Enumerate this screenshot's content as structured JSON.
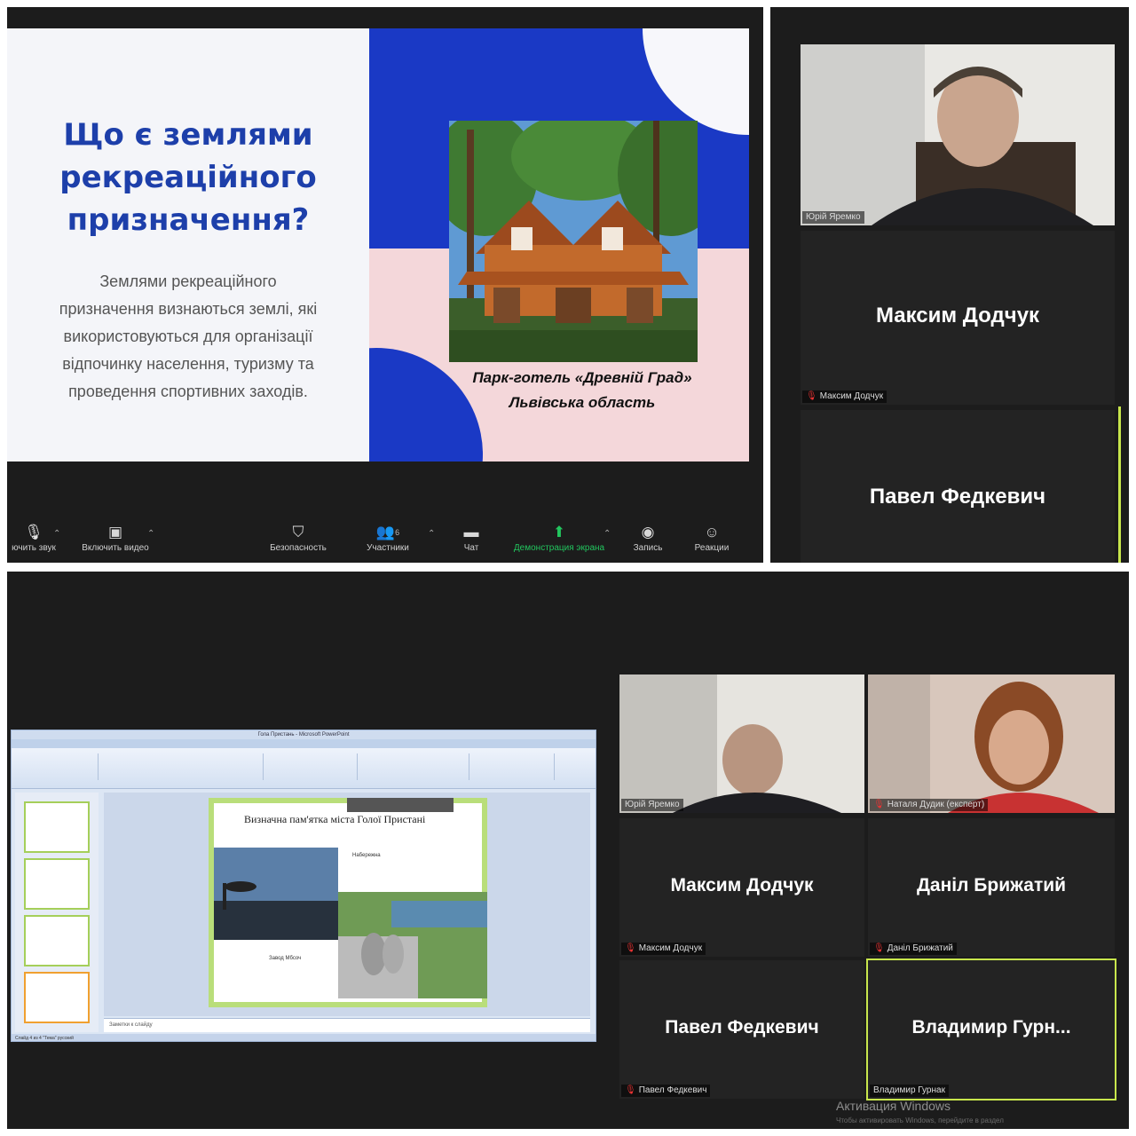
{
  "slide": {
    "title_lines": [
      "Що є землями",
      "рекреаційного",
      "призначення?"
    ],
    "body_lines": [
      "Землями рекреаційного",
      "призначення визнаються землі, які",
      "використовуються для організації",
      "відпочинку населення, туризму та",
      "проведення спортивних заходів."
    ],
    "caption_lines": [
      "Парк-готель «Древній Град»",
      "Львівська область"
    ]
  },
  "toolbar": {
    "mute_label": "ючить звук",
    "video_label": "Включить видео",
    "security_label": "Безопасность",
    "participants_label": "Участники",
    "participants_count": "6",
    "chat_label": "Чат",
    "share_label": "Демонстрация экрана",
    "record_label": "Запись",
    "reactions_label": "Реакции"
  },
  "top_gallery": {
    "tile1_tag": "Юрій Яремко",
    "tile2_name": "Максим Додчук",
    "tile2_tag": "Максим Додчук",
    "tile3_name": "Павел Федкевич"
  },
  "ppt": {
    "window_title": "Гола Пристань - Microsoft PowerPoint",
    "slide_title": "Визначна пам'ятка міста Голої Пристані",
    "label_a": "Набережна",
    "label_b": "Завод Мбсоч",
    "notes": "Заметки к слайду",
    "status": "Слайд 4 из 4   \"Тема\"   русский"
  },
  "bottom_gallery": {
    "tile1_tag": "Юрій Яремко",
    "tile2_tag": "Наталя Дудик (експерт)",
    "tile3_name": "Максим Додчук",
    "tile3_tag": "Максим Додчук",
    "tile4_name": "Даніл Брижатий",
    "tile4_tag": "Даніл Брижатий",
    "tile5_name": "Павел Федкевич",
    "tile5_tag": "Павел Федкевич",
    "tile6_name": "Владимир  Гурн...",
    "tile6_tag": "Владимир Гурнак"
  },
  "watermark": {
    "line1": "Активация Windows",
    "line2": "Чтобы активировать Windows, перейдите в раздел"
  },
  "colors": {
    "slide_blue": "#1a39c5",
    "slide_pink": "#f4d7da",
    "active_speaker": "#c8e64c",
    "share_green": "#22c55e"
  },
  "icons": [
    "mic-muted-icon",
    "video-off-icon",
    "shield-icon",
    "participants-icon",
    "chat-icon",
    "share-screen-icon",
    "record-icon",
    "reactions-icon"
  ]
}
